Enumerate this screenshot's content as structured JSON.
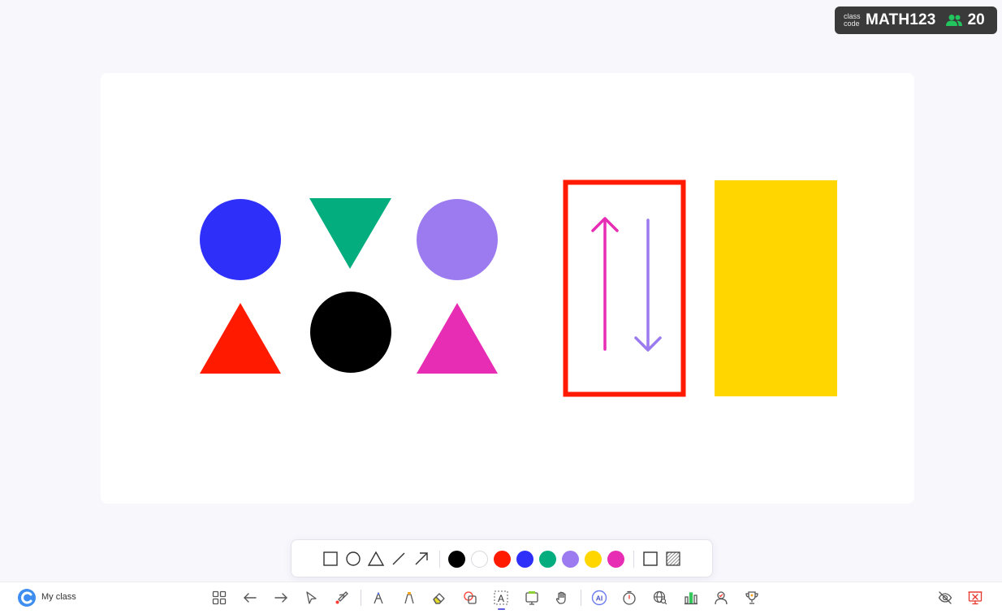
{
  "badge": {
    "class_label_1": "class",
    "class_label_2": "code",
    "code": "MATH123",
    "participants": "20",
    "icon": "people-icon",
    "people_color": "#22c55e"
  },
  "board": {
    "shapes": [
      {
        "type": "circle",
        "color": "#2f2ffa"
      },
      {
        "type": "triangle-down",
        "color": "#03ad7e"
      },
      {
        "type": "circle",
        "color": "#9c7bf0"
      },
      {
        "type": "triangle-up",
        "color": "#ff1a00"
      },
      {
        "type": "circle",
        "color": "#000000"
      },
      {
        "type": "triangle-up",
        "color": "#e82db5"
      },
      {
        "type": "rectangle-outline",
        "color": "#ff1a00"
      },
      {
        "type": "arrow-up",
        "color": "#e82db5"
      },
      {
        "type": "arrow-down",
        "color": "#9c7bf0"
      },
      {
        "type": "rectangle-filled",
        "color": "#ffd600"
      }
    ]
  },
  "palette": {
    "shape_tools": [
      "square-icon",
      "circle-icon",
      "triangle-icon",
      "line-icon",
      "arrow-icon"
    ],
    "colors": [
      "#000000",
      "#ffffff",
      "#ff1a00",
      "#2f2ffa",
      "#03ad7e",
      "#9c7bf0",
      "#ffd600",
      "#e82db5"
    ],
    "fill_modes": [
      "outline-square-icon",
      "hatched-fill-icon"
    ]
  },
  "toolbar": {
    "class_name": "My class",
    "tools": [
      "grid-icon",
      "back-arrow-icon",
      "forward-arrow-icon",
      "select-pointer-icon",
      "laser-pen-icon",
      "pen-icon",
      "highlighter-icon",
      "eraser-icon",
      "shapes-icon",
      "text-icon",
      "sticky-note-icon",
      "hand-icon",
      "ai-icon",
      "timer-icon",
      "web-search-icon",
      "poll-chart-icon",
      "student-pick-icon",
      "trophy-icon"
    ],
    "right_tools": [
      "hide-icon",
      "end-presentation-icon"
    ],
    "active_tool": "text-icon"
  }
}
